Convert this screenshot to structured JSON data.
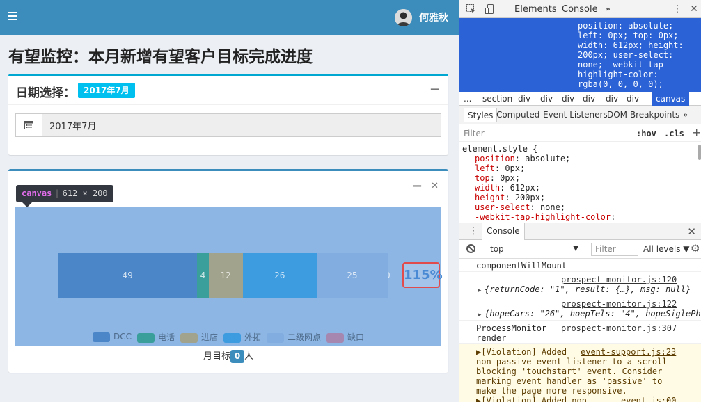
{
  "app": {
    "user_name": "何雅秋",
    "page_title": "有望监控：本月新增有望客户目标完成进度",
    "date_box": {
      "title": "日期选择：",
      "badge": "2017年7月",
      "input_value": "2017年7月"
    },
    "chart_box": {
      "canvas_tip_tag": "canvas",
      "canvas_tip_size": "612 × 200",
      "percent": "115%",
      "target_prefix": "月目标",
      "target_value": "0",
      "target_suffix": "人"
    },
    "colors": {
      "header": "#3c8dbc",
      "badge": "#00c0ef",
      "chart_bg": "#8db6e4",
      "highlight": "#e24b4b"
    }
  },
  "chart_data": {
    "type": "bar",
    "orientation": "horizontal-stacked",
    "series": [
      {
        "name": "DCC",
        "value": 49,
        "color": "#4a86c8"
      },
      {
        "name": "电话",
        "value": 4,
        "color": "#3a9f9a"
      },
      {
        "name": "进店",
        "value": 12,
        "color": "#a2a38c"
      },
      {
        "name": "外拓",
        "value": 26,
        "color": "#3d9be0"
      },
      {
        "name": "二级网点",
        "value": 25,
        "color": "#82ade0"
      },
      {
        "name": "缺口",
        "value": 0,
        "color": "#a587b0"
      }
    ],
    "total_label": "115%",
    "legend": "bottom"
  },
  "devtools": {
    "tabs": {
      "elements": "Elements",
      "console": "Console",
      "more": "»"
    },
    "element_code": "position: absolute;\nleft: 0px; top: 0px;\nwidth: 612px; height:\n200px; user-select:\nnone; -webkit-tap-\nhighlight-color:\nrgba(0, 0, 0, 0);",
    "breadcrumb": [
      "...",
      "section",
      "div",
      "div",
      "div",
      "div",
      "div",
      "div",
      "canvas"
    ],
    "subtabs": [
      "Styles",
      "Computed",
      "Event Listeners",
      "DOM Breakpoints",
      "»"
    ],
    "filter_placeholder": "Filter",
    "hov": ":hov",
    "cls": ".cls",
    "selector": "element.style {",
    "declarations": [
      {
        "prop": "position",
        "val": "absolute;"
      },
      {
        "prop": "left",
        "val": "0px;"
      },
      {
        "prop": "top",
        "val": "0px;"
      },
      {
        "prop": "width",
        "val": "612px;"
      },
      {
        "prop": "height",
        "val": "200px;"
      },
      {
        "prop": "user-select",
        "val": "none;"
      },
      {
        "prop": "-webkit-tap-highlight-color",
        "val": ""
      }
    ],
    "drawer_tab": "Console",
    "context": "top",
    "console_filter": "Filter",
    "levels": "All levels ▼",
    "logs": {
      "l1_text": "componentWillMount",
      "l2_src": "prospect-monitor.js:120",
      "l2_text": "{returnCode: \"1\", result: {…}, msg: null}",
      "l3_src": "prospect-monitor.js:122",
      "l3_text": "{hopeCars: \"26\", hoepTels: \"4\", hopeSiglePh",
      "l4_text": "ProcessMonitor\nrender",
      "l4_src": "prospect-monitor.js:307",
      "warn_text": "▶[Violation] Added\nnon-passive event listener to a scroll-\nblocking 'touchstart' event. Consider\nmarking event handler as 'passive' to\nmake the page more responsive.",
      "warn_src": "event-support.js:23",
      "warn2_text": "▶[Violation] Added non-",
      "warn2_src": "event.js:00"
    }
  }
}
